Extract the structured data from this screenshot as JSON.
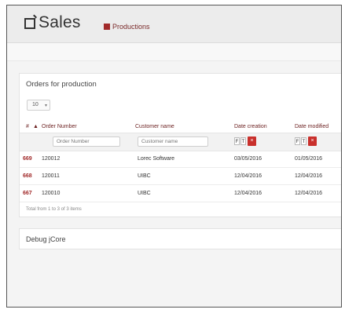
{
  "header": {
    "title": "Sales",
    "breadcrumb": "Productions"
  },
  "panel": {
    "title": "Orders for production",
    "length_value": "10",
    "columns": [
      "#",
      "Order Number",
      "Customer name",
      "Date creation",
      "Date modified"
    ],
    "filters": {
      "order_number_placeholder": "Order Number",
      "customer_placeholder": "Customer name"
    },
    "rows": [
      {
        "id": "669",
        "order": "120012",
        "customer": "Lorec Software",
        "created": "03/05/2016",
        "modified": "01/05/2016"
      },
      {
        "id": "668",
        "order": "120011",
        "customer": "UIBC",
        "created": "12/04/2016",
        "modified": "12/04/2016"
      },
      {
        "id": "667",
        "order": "120010",
        "customer": "UIBC",
        "created": "12/04/2016",
        "modified": "12/04/2016"
      }
    ],
    "info": "Total from 1 to 3 of 3 items"
  },
  "debug": {
    "title": "Debug jCore"
  },
  "colors": {
    "accent": "#a12a2a",
    "clear_button": "#c9302c"
  }
}
